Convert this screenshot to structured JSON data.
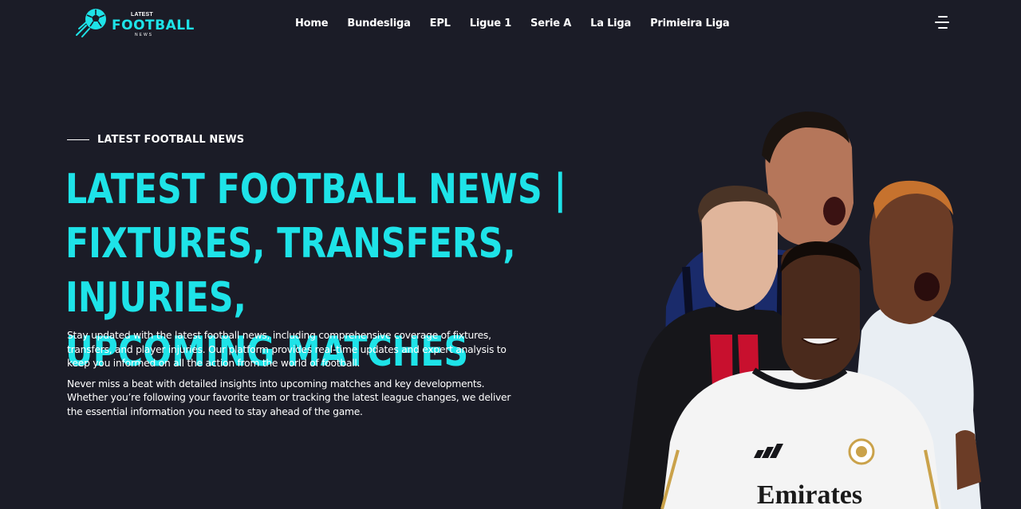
{
  "header": {
    "logo": {
      "small": "LATEST",
      "main": "FOOTBALL",
      "sub": "NEWS"
    },
    "nav": [
      {
        "label": "Home"
      },
      {
        "label": "Bundesliga"
      },
      {
        "label": "EPL"
      },
      {
        "label": "Ligue 1"
      },
      {
        "label": "Serie A"
      },
      {
        "label": "La Liga"
      },
      {
        "label": "Primieira Liga"
      }
    ],
    "menu_icon": "hamburger-menu-icon"
  },
  "hero": {
    "eyebrow": "LATEST FOOTBALL NEWS",
    "title_lines": [
      "LATEST FOOTBALL NEWS |",
      "FIXTURES, TRANSFERS, INJURIES,",
      "UPCOMING MATCHES"
    ],
    "paragraphs": [
      "Stay updated with the latest football news, including comprehensive coverage of fixtures, transfers, and player injuries. Our platform provides real-time updates and expert analysis to keep you informed on all the action from the world of football.",
      "Never miss a beat with detailed insights into upcoming matches and key developments. Whether you’re following your favorite team or tracking the latest league changes, we deliver the essential information you need to stay ahead of the game."
    ],
    "image_shirt_text": "Emirates"
  },
  "colors": {
    "background": "#1b1c27",
    "accent": "#1ee3e8",
    "text": "#ffffff"
  }
}
